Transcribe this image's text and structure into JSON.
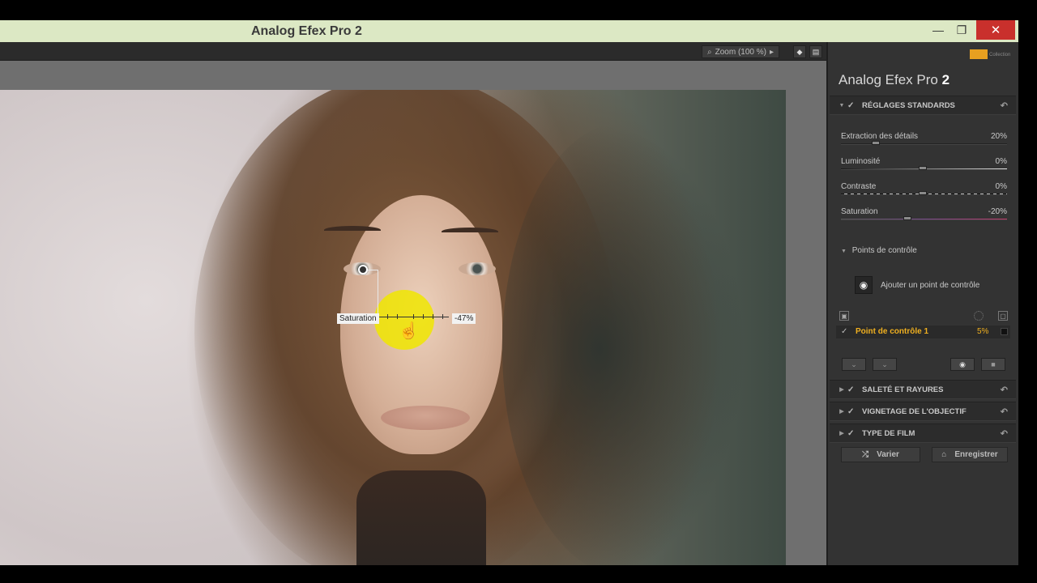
{
  "window": {
    "title": "Analog Efex Pro 2",
    "minimize_glyph": "—",
    "maximize_glyph": "❐",
    "close_glyph": "✕"
  },
  "toolbar": {
    "zoom_label": "Zoom (100 %)",
    "zoom_icon": "magnifier-icon",
    "zoom_arrow": "▸",
    "preview_icon_glyph": "◆",
    "compare_icon_glyph": "▤"
  },
  "canvas": {
    "overlay_label": "Saturation",
    "overlay_value": "-47%"
  },
  "panel": {
    "brand_mark": "nik",
    "brand_sub": "Collection",
    "app_name": "Analog Efex Pro",
    "app_version": "2",
    "standard": {
      "title": "RÉGLAGES STANDARDS",
      "sliders": [
        {
          "name": "Extraction des détails",
          "value": "20%",
          "level": 0.2
        },
        {
          "name": "Luminosité",
          "value": "0%",
          "level": 0.5
        },
        {
          "name": "Contraste",
          "value": "0%",
          "level": 0.5
        },
        {
          "name": "Saturation",
          "value": "-20%",
          "level": 0.4
        }
      ]
    },
    "control_points": {
      "title": "Points de contrôle",
      "add_label": "Ajouter un point de contrôle",
      "items": [
        {
          "name": "Point de contrôle 1",
          "value": "5%"
        }
      ]
    },
    "sections": [
      {
        "title": "SALETÉ ET RAYURES"
      },
      {
        "title": "VIGNETAGE DE L'OBJECTIF"
      },
      {
        "title": "TYPE DE FILM"
      }
    ],
    "footer": {
      "vary_label": "Varier",
      "save_label": "Enregistrer"
    }
  },
  "colors": {
    "titlebar": "#dce8c4",
    "close": "#c9302c",
    "panel": "#333333",
    "accent": "#f0b020",
    "highlight": "#f0e600"
  }
}
